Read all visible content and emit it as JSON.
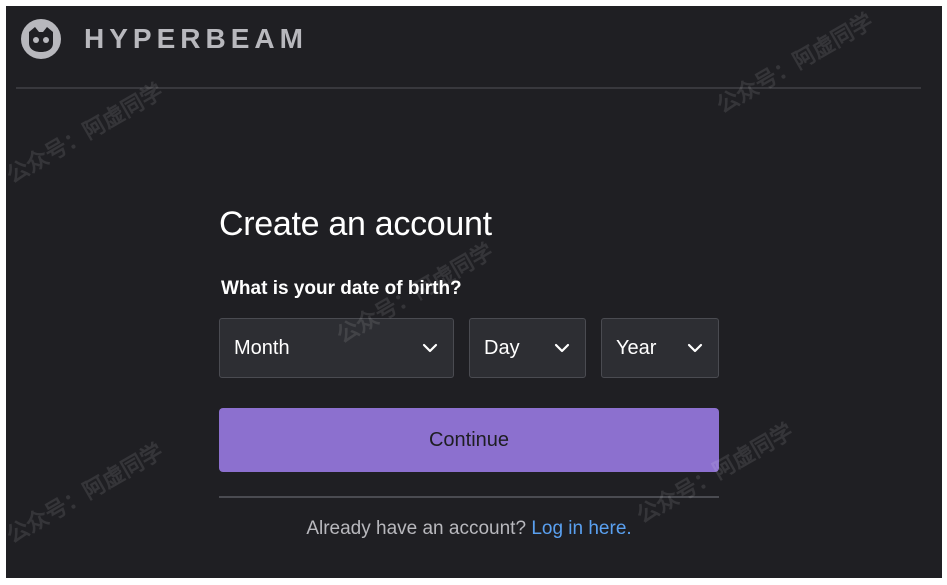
{
  "header": {
    "brand": "HYPERBEAM",
    "logo_icon": "hyperbeam-cat-logo-icon"
  },
  "form": {
    "title": "Create an account",
    "dob_label": "What is your date of birth?",
    "month": {
      "value": "Month",
      "icon": "chevron-down-icon"
    },
    "day": {
      "value": "Day",
      "icon": "chevron-down-icon"
    },
    "year": {
      "value": "Year",
      "icon": "chevron-down-icon"
    },
    "continue_label": "Continue"
  },
  "footer": {
    "prompt": "Already have an account? ",
    "login_link": "Log in here."
  },
  "watermark": {
    "text": "公众号：阿虚同学"
  },
  "colors": {
    "background": "#1f1f23",
    "select_bg": "#2d2e33",
    "accent": "#8c70cf",
    "link": "#5aa0f0"
  }
}
